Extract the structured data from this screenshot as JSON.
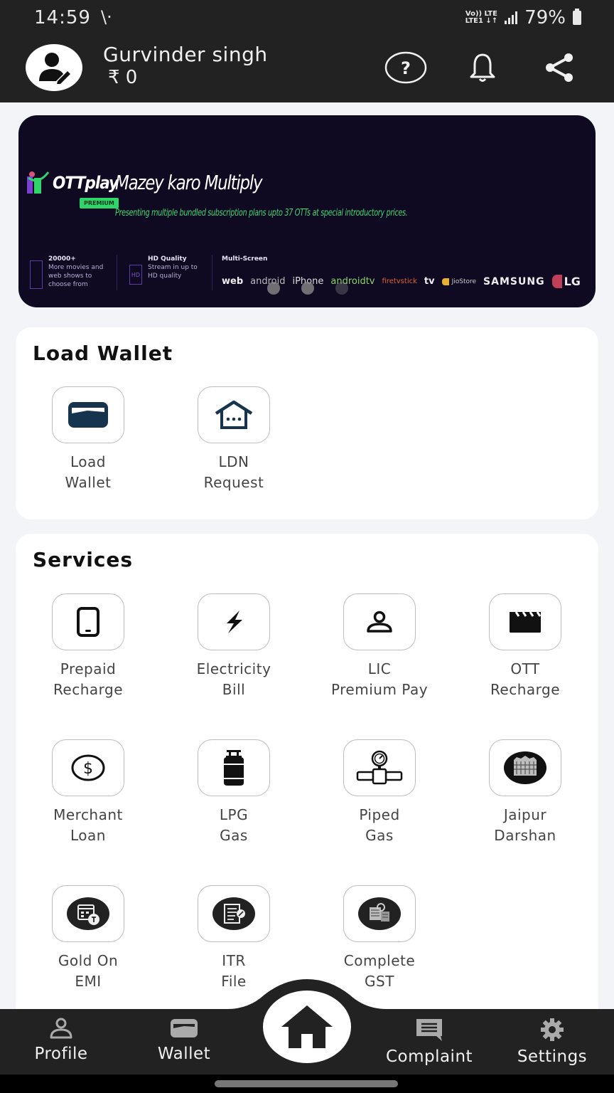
{
  "status_bar": {
    "time": "14:59",
    "extra_icon": "\\·",
    "network_top": "Vo)) LTE",
    "network_bottom": "LTE1 ↓↑",
    "battery": "79%"
  },
  "header": {
    "user_name": "Gurvinder singh",
    "balance": "₹ 0",
    "icons": [
      "help-icon",
      "notification-bell-icon",
      "share-icon"
    ]
  },
  "banner": {
    "brand": "OTTplay",
    "badge": "PREMIUM",
    "title": "Mazey karo Multiply",
    "subtitle": "Presenting multiple bundled subscription plans upto 37 OTTs at special introductory prices.",
    "features": [
      {
        "title": "20000+",
        "text": "More movies and web shows to choose from"
      },
      {
        "title": "HD Quality",
        "text": "Stream in up to HD quality"
      },
      {
        "title": "Multi-Screen",
        "text": ""
      }
    ],
    "platforms": [
      "web",
      "android",
      "iPhone",
      "androidtv",
      "firetvstick",
      "tv",
      "JioStore",
      "SAMSUNG",
      "LG"
    ],
    "carousel_dots": 3
  },
  "load_wallet": {
    "title": "Load Wallet",
    "items": [
      {
        "label": "Load\nWallet",
        "icon": "wallet-card-icon"
      },
      {
        "label": "LDN\nRequest",
        "icon": "house-icon"
      }
    ]
  },
  "services": {
    "title": "Services",
    "items": [
      {
        "label": "Prepaid\nRecharge",
        "icon": "mobile-phone-icon"
      },
      {
        "label": "Electricity\nBill",
        "icon": "lightning-icon"
      },
      {
        "label": "LIC\nPremium Pay",
        "icon": "person-icon"
      },
      {
        "label": "OTT\nRecharge",
        "icon": "clapperboard-icon"
      },
      {
        "label": "Merchant\nLoan",
        "icon": "dollar-coin-icon"
      },
      {
        "label": "LPG\nGas",
        "icon": "gas-cylinder-icon"
      },
      {
        "label": "Piped\nGas",
        "icon": "gas-pipe-gauge-icon"
      },
      {
        "label": "Jaipur\nDarshan",
        "icon": "hawa-mahal-icon"
      },
      {
        "label": "Gold On\nEMI",
        "icon": "calendar-emi-icon"
      },
      {
        "label": "ITR\nFile",
        "icon": "tax-document-icon"
      },
      {
        "label": "Complete\nGST",
        "icon": "gst-calculator-icon"
      }
    ]
  },
  "bottom_nav": {
    "items": [
      {
        "label": "Profile",
        "icon": "profile-icon"
      },
      {
        "label": "Wallet",
        "icon": "wallet-icon"
      },
      {
        "label": "Home",
        "icon": "home-icon"
      },
      {
        "label": "Complaint",
        "icon": "complaint-icon"
      },
      {
        "label": "Settings",
        "icon": "settings-gear-icon"
      }
    ]
  },
  "colors": {
    "header_bg": "#222222",
    "banner_bg": "#0f0a22",
    "banner_green": "#3fd36e",
    "icon_navy": "#17344f",
    "page_bg": "#f2f4f8"
  }
}
